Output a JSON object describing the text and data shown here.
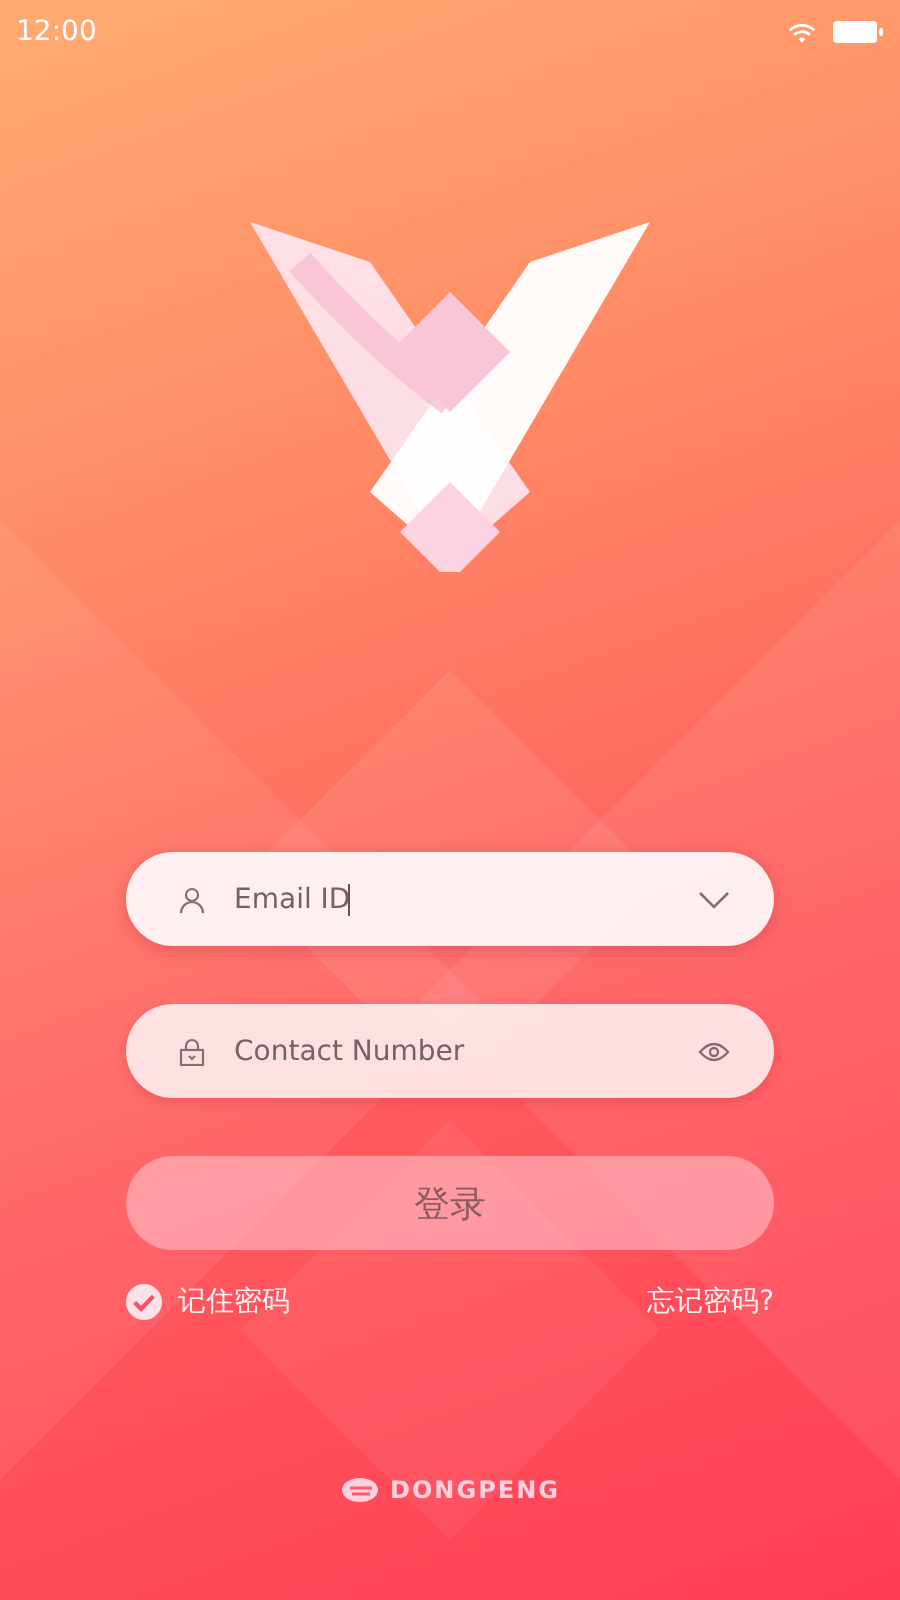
{
  "status_bar": {
    "time": "12:00"
  },
  "fields": [
    {
      "kind": "account",
      "placeholder": "Email ID",
      "focused": true
    },
    {
      "kind": "password",
      "placeholder": "Contact Number",
      "focused": false
    }
  ],
  "login_button": {
    "label": "登录"
  },
  "remember": {
    "label": "记住密码",
    "checked": true
  },
  "forgot_link": {
    "label": "忘记密码?"
  },
  "footer": {
    "brand": "DONGPENG"
  }
}
